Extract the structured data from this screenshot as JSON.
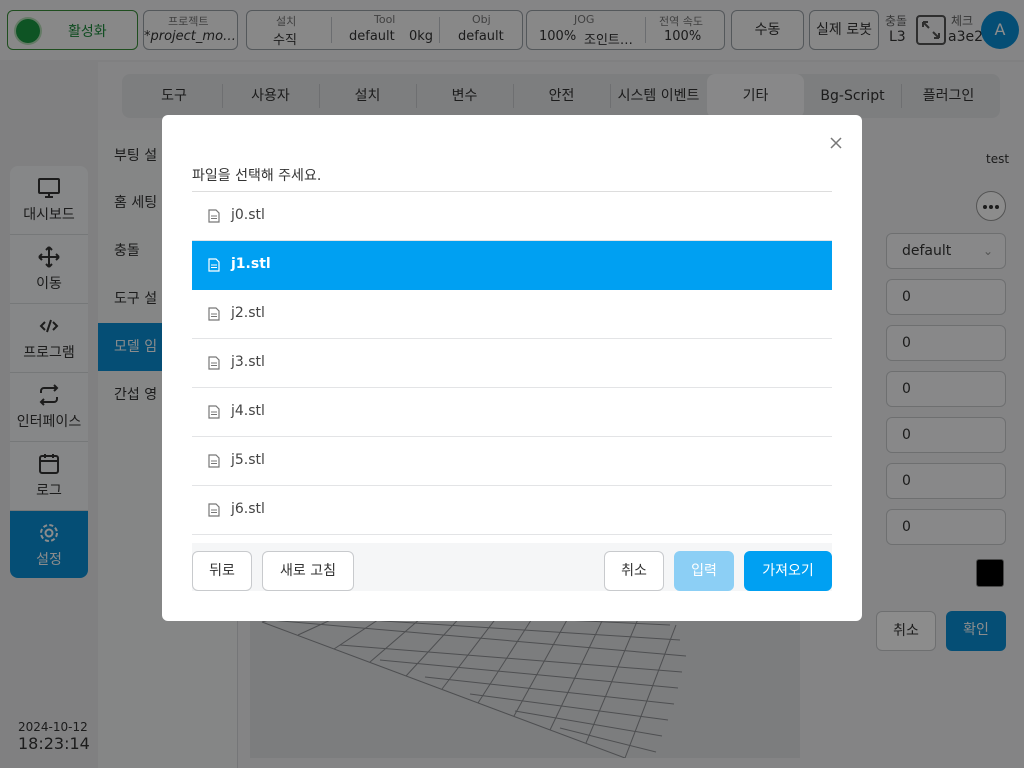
{
  "topbar": {
    "activate_label": "활성화",
    "project_label": "프로젝트",
    "project_value": "*project_mo…",
    "install_label": "설치",
    "install_value": "수직",
    "tool_label": "Tool",
    "tool_value": "default",
    "tool_weight": "0kg",
    "obj_label": "Obj",
    "obj_value": "default",
    "jog_label": "JOG",
    "jog_percent": "100%",
    "jog_mode": "조인트…",
    "speed_label": "전역 속도",
    "speed_value": "100%",
    "manual_button": "수동",
    "real_robot_button": "실제 로봇",
    "collision_label": "충돌",
    "collision_value": "L3",
    "check_label": "체크",
    "check_value": "a3e2",
    "avatar_letter": "A"
  },
  "sidebar": {
    "items": [
      {
        "label": "대시보드",
        "icon": "monitor-icon"
      },
      {
        "label": "이동",
        "icon": "move-arrows-icon"
      },
      {
        "label": "프로그램",
        "icon": "code-icon"
      },
      {
        "label": "인터페이스",
        "icon": "swap-arrows-icon"
      },
      {
        "label": "로그",
        "icon": "calendar-icon"
      },
      {
        "label": "설정",
        "icon": "gear-icon",
        "active": true
      }
    ],
    "date": "2024-10-12",
    "time": "18:23:14"
  },
  "tabs": {
    "items": [
      "도구",
      "사용자",
      "설치",
      "변수",
      "안전",
      "시스템 이벤트",
      "기타",
      "Bg-Script",
      "플러그인"
    ],
    "active": "기타"
  },
  "leftnav": {
    "items": [
      "부팅 설",
      "홈 세팅",
      "충돌",
      "도구 설",
      "모델 임",
      "간섭 영"
    ],
    "active_index": 4
  },
  "form": {
    "name_value": "test",
    "select_value": "default",
    "inputs": [
      "0",
      "0",
      "0",
      "0",
      "0",
      "0"
    ],
    "cancel_button": "취소",
    "confirm_button": "확인",
    "color_value": "#000000"
  },
  "dialog": {
    "title": "파일을 선택해 주세요.",
    "files": [
      "j0.stl",
      "j1.stl",
      "j2.stl",
      "j3.stl",
      "j4.stl",
      "j5.stl",
      "j6.stl"
    ],
    "selected_file": "j1.stl",
    "back_button": "뒤로",
    "refresh_button": "새로 고침",
    "cancel_button": "취소",
    "input_button": "입력",
    "import_button": "가져오기"
  },
  "colors": {
    "accent": "#0a8fd6",
    "selection": "#00a0f2",
    "active_green": "#1a9a43"
  }
}
